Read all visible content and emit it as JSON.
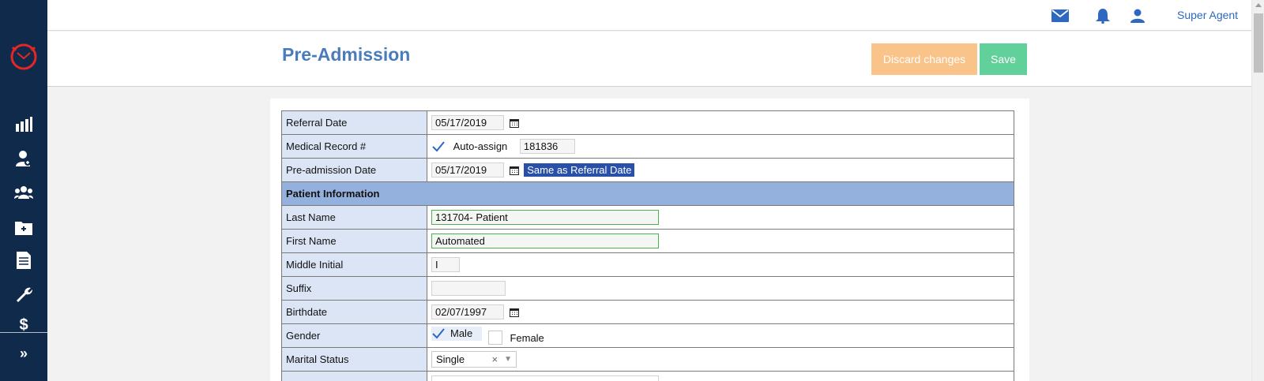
{
  "topbar": {
    "user_name": "Super Agent",
    "icons": [
      "mail-icon",
      "bell-icon",
      "user-icon"
    ]
  },
  "sidebar": {
    "items": [
      "dashboard-icon",
      "patient-icon",
      "group-icon",
      "folder-add-icon",
      "document-icon",
      "wrench-icon",
      "billing-icon"
    ],
    "expand_label": "»"
  },
  "header": {
    "title": "Pre-Admission",
    "discard_label": "Discard changes",
    "save_label": "Save"
  },
  "colors": {
    "sidebar": "#0f2a4a",
    "title": "#4a7bbb",
    "discard": "#f9c38a",
    "save": "#62d09a",
    "label_bg": "#dbe5f5",
    "section_bg": "#94b0dc",
    "same_button": "#2950a8"
  },
  "form": {
    "referral_date": {
      "label": "Referral Date",
      "value": "05/17/2019"
    },
    "medical_record": {
      "label": "Medical Record #",
      "auto_assign_label": "Auto-assign",
      "value": "181836"
    },
    "preadmission_date": {
      "label": "Pre-admission Date",
      "value": "05/17/2019",
      "same_as_label": "Same as Referral Date"
    },
    "section_patient": "Patient Information",
    "last_name": {
      "label": "Last Name",
      "value": "131704- Patient"
    },
    "first_name": {
      "label": "First Name",
      "value": "Automated"
    },
    "middle_initial": {
      "label": "Middle Initial",
      "value": "I"
    },
    "suffix": {
      "label": "Suffix",
      "value": ""
    },
    "birthdate": {
      "label": "Birthdate",
      "value": "02/07/1997"
    },
    "gender": {
      "label": "Gender",
      "male_label": "Male",
      "female_label": "Female",
      "selected": "Male"
    },
    "marital_status": {
      "label": "Marital Status",
      "value": "Single",
      "clear": "×",
      "arrow": "▼"
    }
  }
}
